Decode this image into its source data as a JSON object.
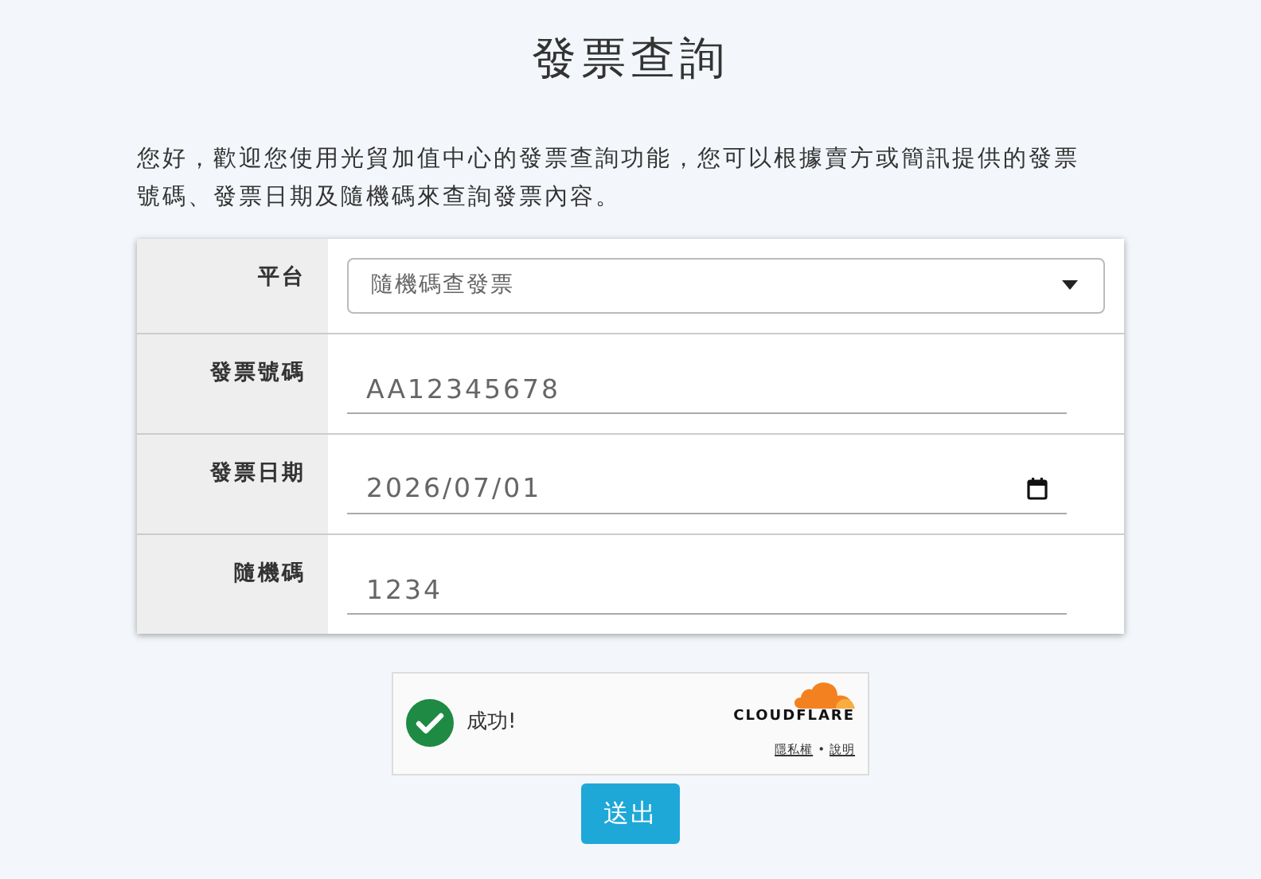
{
  "title": "發票查詢",
  "intro": "您好，歡迎您使用光貿加值中心的發票查詢功能，您可以根據賣方或簡訊提供的發票號碼、發票日期及隨機碼來查詢發票內容。",
  "form_rows": [
    {
      "kind": "select",
      "label": "平台",
      "value": "隨機碼查發票"
    },
    {
      "kind": "text",
      "label": "發票號碼",
      "placeholder": "AA12345678"
    },
    {
      "kind": "date",
      "label": "發票日期",
      "value": "2026/07/01"
    },
    {
      "kind": "text",
      "label": "隨機碼",
      "placeholder": "1234"
    }
  ],
  "captcha": {
    "success": true,
    "status": "成功!",
    "brand": "CLOUDFLARE",
    "links": [
      "隱私權",
      "說明"
    ],
    "separator": "•"
  },
  "submit_button": "送出"
}
